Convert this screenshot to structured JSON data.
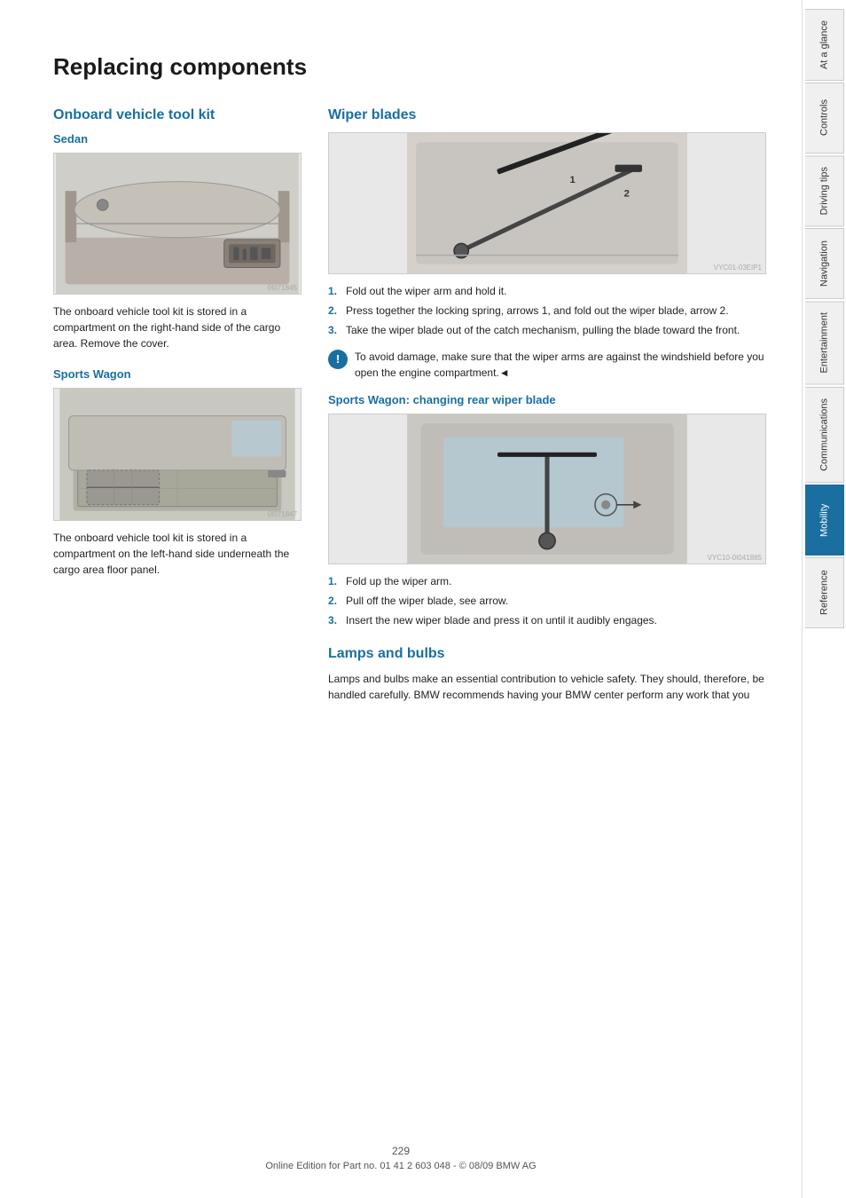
{
  "page": {
    "title": "Replacing components",
    "page_number": "229",
    "footer_text": "Online Edition for Part no. 01 41 2 603 048 - © 08/09 BMW AG"
  },
  "left_column": {
    "section_heading": "Onboard vehicle tool kit",
    "sedan": {
      "label": "Sedan",
      "image_code": "0I071845",
      "body_text": "The onboard vehicle tool kit is stored in a compartment on the right-hand side of the cargo area. Remove the cover."
    },
    "sports_wagon": {
      "label": "Sports Wagon",
      "image_code": "0I071847",
      "body_text": "The onboard vehicle tool kit is stored in a compartment on the left-hand side underneath the cargo area floor panel."
    }
  },
  "right_column": {
    "wiper_blades": {
      "heading": "Wiper blades",
      "image_code": "VYC01-03EIP1",
      "steps": [
        {
          "num": "1.",
          "text": "Fold out the wiper arm and hold it."
        },
        {
          "num": "2.",
          "text": "Press together the locking spring, arrows 1, and fold out the wiper blade, arrow 2."
        },
        {
          "num": "3.",
          "text": "Take the wiper blade out of the catch mechanism, pulling the blade toward the front."
        }
      ],
      "warning": "To avoid damage, make sure that the wiper arms are against the windshield before you open the engine compartment.◄"
    },
    "rear_wiper": {
      "heading": "Sports Wagon: changing rear wiper blade",
      "image_code": "VYC10-0I041885",
      "steps": [
        {
          "num": "1.",
          "text": "Fold up the wiper arm."
        },
        {
          "num": "2.",
          "text": "Pull off the wiper blade, see arrow."
        },
        {
          "num": "3.",
          "text": "Insert the new wiper blade and press it on until it audibly engages."
        }
      ]
    },
    "lamps_and_bulbs": {
      "heading": "Lamps and bulbs",
      "body_text": "Lamps and bulbs make an essential contribution to vehicle safety. They should, therefore, be handled carefully. BMW recommends having your BMW center perform any work that you"
    }
  },
  "sidebar": {
    "tabs": [
      {
        "label": "At a glance",
        "active": false
      },
      {
        "label": "Controls",
        "active": false
      },
      {
        "label": "Driving tips",
        "active": false
      },
      {
        "label": "Navigation",
        "active": false
      },
      {
        "label": "Entertainment",
        "active": false
      },
      {
        "label": "Communications",
        "active": false
      },
      {
        "label": "Mobility",
        "active": true
      },
      {
        "label": "Reference",
        "active": false
      }
    ]
  }
}
